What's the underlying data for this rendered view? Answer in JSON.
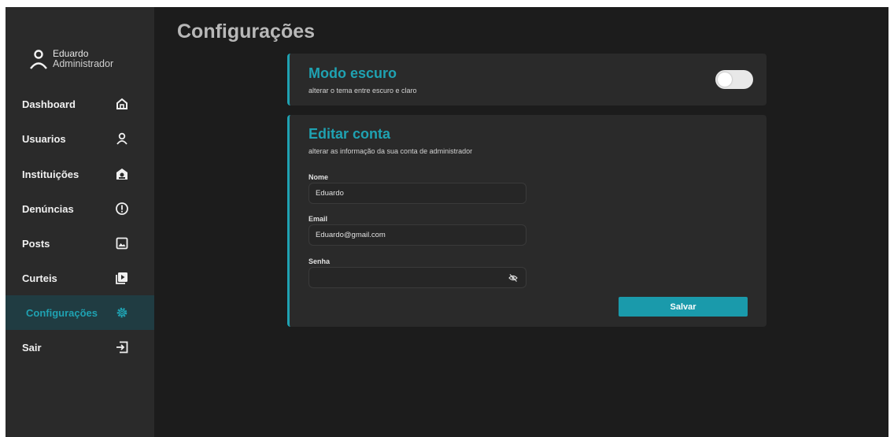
{
  "user": {
    "name": "Eduardo",
    "role": "Administrador"
  },
  "nav": [
    {
      "label": "Dashboard",
      "icon": "home-icon"
    },
    {
      "label": "Usuarios",
      "icon": "user-icon"
    },
    {
      "label": "Instituições",
      "icon": "institution-icon"
    },
    {
      "label": "Denúncias",
      "icon": "alert-icon"
    },
    {
      "label": "Posts",
      "icon": "image-icon"
    },
    {
      "label": "Curteis",
      "icon": "video-icon"
    },
    {
      "label": "Configurações",
      "icon": "gear-icon",
      "active": true
    },
    {
      "label": "Sair",
      "icon": "logout-icon"
    }
  ],
  "page": {
    "title": "Configurações"
  },
  "dark_mode": {
    "title": "Modo escuro",
    "subtitle": "alterar o tema entre escuro e claro",
    "enabled": false
  },
  "account": {
    "title": "Editar conta",
    "subtitle": "alterar as informação da sua conta de administrador",
    "name_label": "Nome",
    "name_value": "Eduardo",
    "email_label": "Email",
    "email_value": "Eduardo@gmail.com",
    "password_label": "Senha",
    "password_value": "",
    "save_label": "Salvar"
  },
  "colors": {
    "accent": "#1fa2b2",
    "background": "#1c1c1c",
    "sidebar": "#2a2a2a",
    "active_nav": "#203c42"
  }
}
